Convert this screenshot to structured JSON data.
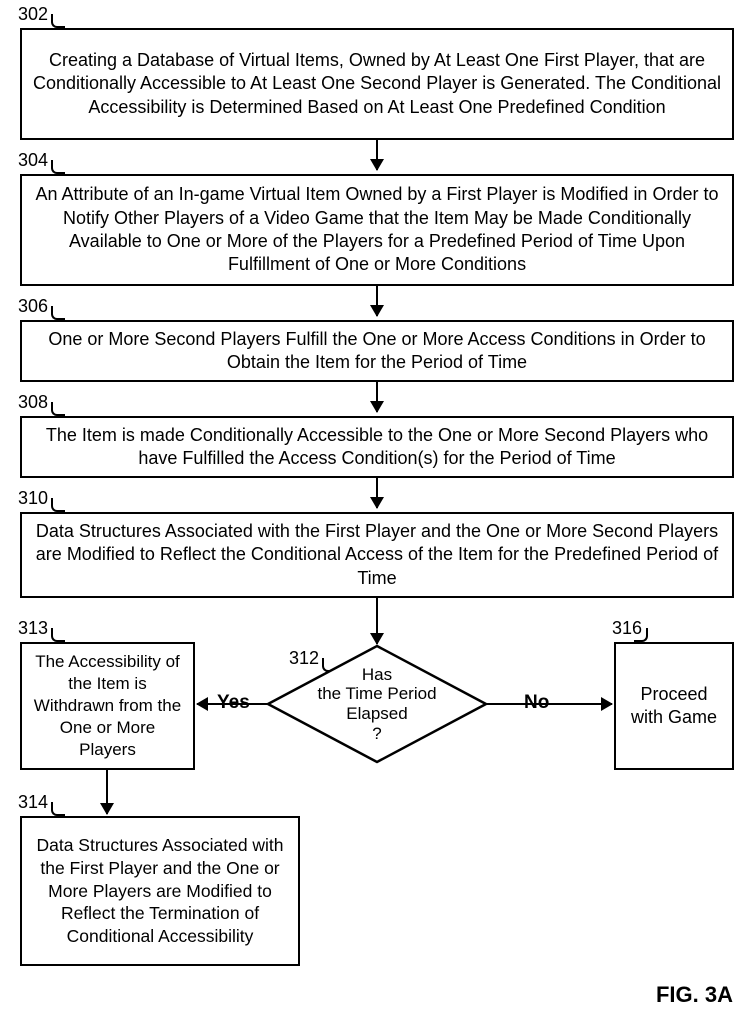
{
  "refs": {
    "r302": "302",
    "r304": "304",
    "r306": "306",
    "r308": "308",
    "r310": "310",
    "r312": "312",
    "r313": "313",
    "r314": "314",
    "r316": "316"
  },
  "boxes": {
    "b302": "Creating a Database of Virtual Items, Owned by At Least One First Player, that are Conditionally Accessible to At Least One Second Player is Generated. The Conditional Accessibility is Determined Based on At Least One Predefined Condition",
    "b304": "An Attribute of an In-game Virtual Item Owned by a First Player is Modified in Order to Notify Other Players of a Video Game that the Item May be Made Conditionally Available to One or More of the Players for a Predefined Period of Time Upon Fulfillment of One or More Conditions",
    "b306": "One or More Second Players Fulfill the One or More Access Conditions in Order to Obtain the Item for the Period of Time",
    "b308": "The Item is made Conditionally Accessible to the One or More Second Players who have Fulfilled the Access Condition(s) for the Period of Time",
    "b310": "Data Structures Associated with the First Player and the One or More Second Players are Modified to Reflect the Conditional Access of the Item for the Predefined Period of Time",
    "b313": "The Accessibility of the Item is Withdrawn from the One or More Players",
    "b314": "Data Structures Associated with the First Player and the One or More Players are Modified to Reflect the Termination of Conditional Accessibility",
    "b316": "Proceed with Game"
  },
  "decision": {
    "d312": "Has\nthe Time Period\nElapsed\n?"
  },
  "labels": {
    "yes": "Yes",
    "no": "No"
  },
  "figure": "FIG. 3A"
}
